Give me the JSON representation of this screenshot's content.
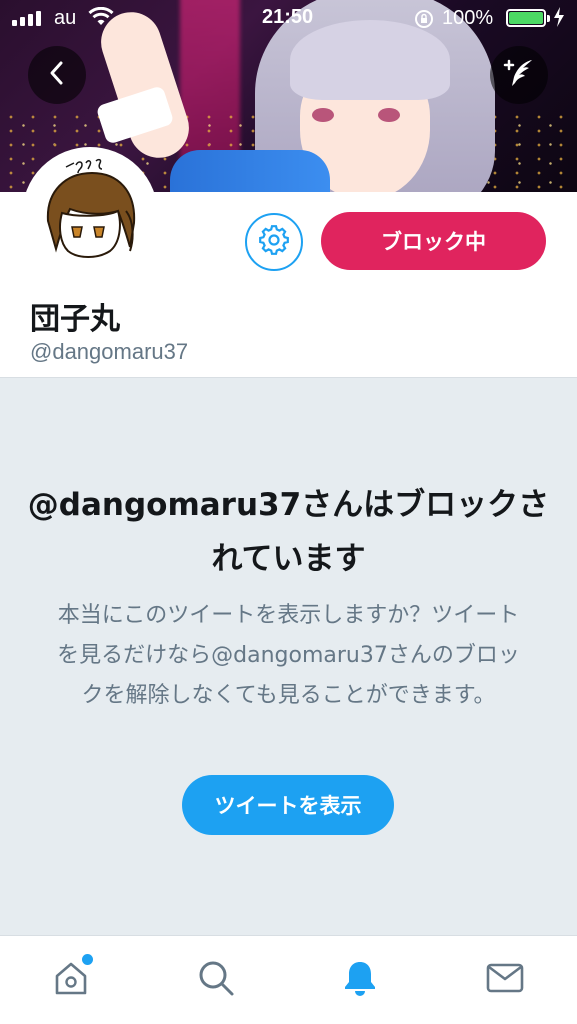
{
  "status_bar": {
    "carrier": "au",
    "time": "21:50",
    "battery_percent": "100%",
    "battery_level": 1.0,
    "signal_bars": 4
  },
  "header": {
    "back_icon": "chevron-left-icon",
    "compose_icon": "compose-tweet-icon"
  },
  "profile": {
    "display_name": "団子丸",
    "handle": "@dangomaru37",
    "settings_icon": "gear-icon",
    "block_button_label": "ブロック中"
  },
  "blocked": {
    "title": "@dangomaru37さんはブロックされています",
    "description": "本当にこのツイートを表示しますか？ツイートを見るだけなら@dangomaru37さんのブロックを解除しなくても見ることができます。",
    "show_button_label": "ツイートを表示"
  },
  "tabbar": {
    "items": [
      {
        "name": "home",
        "icon": "home-icon",
        "active": false,
        "has_notification_dot": true
      },
      {
        "name": "search",
        "icon": "search-icon",
        "active": false
      },
      {
        "name": "notifications",
        "icon": "bell-icon",
        "active": true
      },
      {
        "name": "messages",
        "icon": "envelope-icon",
        "active": false
      }
    ]
  },
  "colors": {
    "accent_blue": "#1da1f2",
    "block_red": "#e0245e",
    "panel_bg": "#e6ecf0",
    "secondary_text": "#657786",
    "primary_text": "#14171a",
    "battery_green": "#4cd964"
  }
}
